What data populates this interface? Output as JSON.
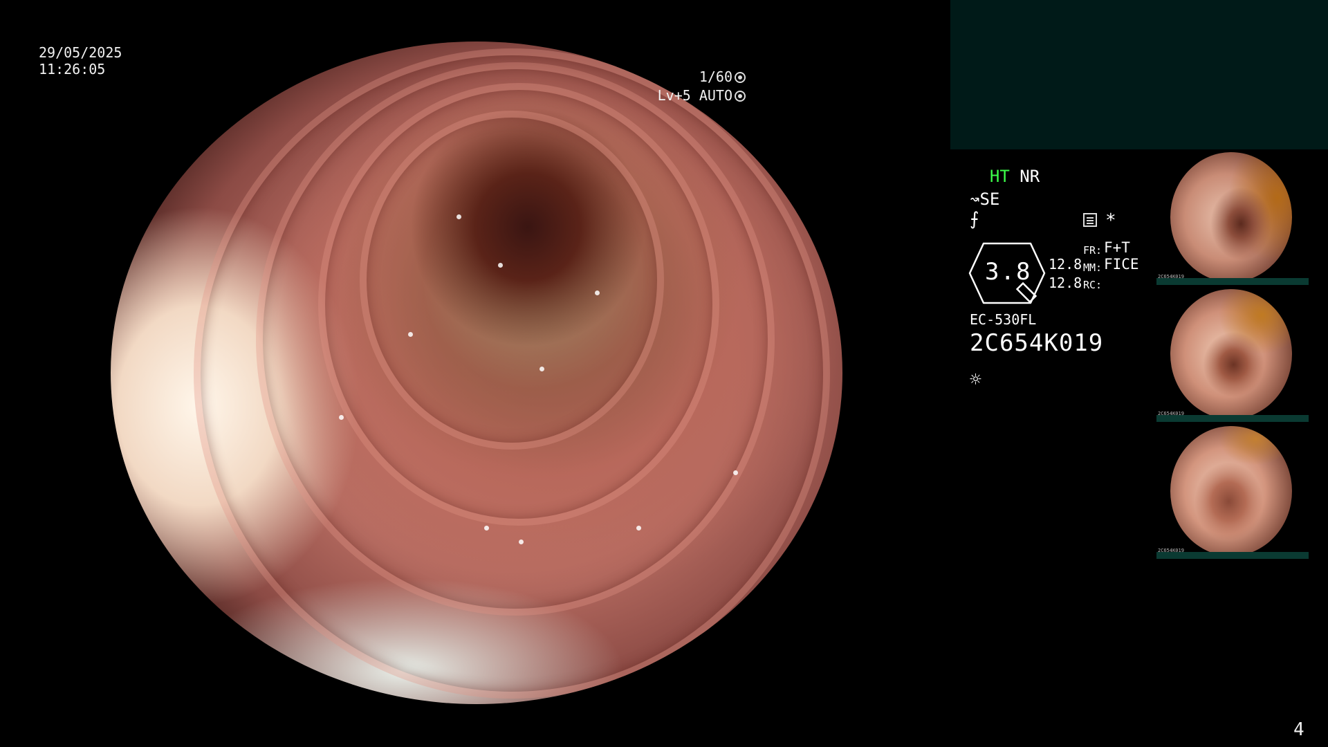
{
  "overlay": {
    "date": "29/05/2025",
    "time": "11:26:05",
    "shutter": "1/60",
    "level": "Lv+5",
    "iris": "AUTO"
  },
  "status": {
    "ht": "HT",
    "nr": "NR",
    "se": "SE"
  },
  "settings": {
    "dial_value": "3.8",
    "mm_value_1": "12.8",
    "mm_value_2": "12.8",
    "fr_label": "FR:",
    "fr_value": "F+T",
    "mm_label": "MM:",
    "mm_value": "FICE",
    "rc_label": "RC:",
    "asterisk": "*"
  },
  "scope": {
    "model": "EC-530FL",
    "serial": "2C654K019"
  },
  "thumbnails": [
    {
      "label": "2C654K019"
    },
    {
      "label": "2C654K019"
    },
    {
      "label": "2C654K019"
    }
  ],
  "page_number": "4",
  "icons": {
    "shutter": "aperture-icon",
    "iris": "auto-iris-icon",
    "structure": "structure-enhance-icon",
    "edge": "edge-icon",
    "menu": "menu-icon",
    "brightness": "brightness-icon"
  }
}
